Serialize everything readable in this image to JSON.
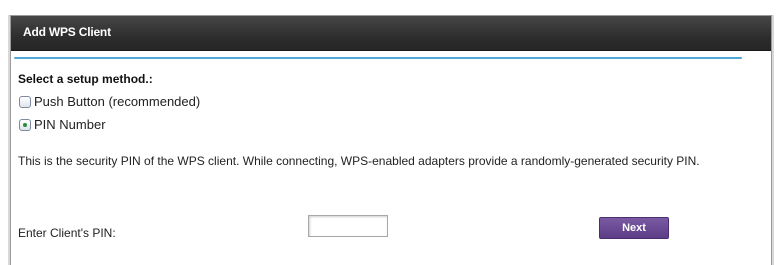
{
  "dialog": {
    "title": "Add WPS Client"
  },
  "setup": {
    "heading": "Select a setup method.:",
    "options": [
      {
        "label": "Push Button (recommended)",
        "selected": false
      },
      {
        "label": "PIN Number",
        "selected": true
      }
    ]
  },
  "description": "This is the security PIN of the WPS client. While connecting, WPS-enabled adapters provide a randomly-generated security PIN.",
  "pin": {
    "label": "Enter Client's PIN:",
    "value": "",
    "placeholder": ""
  },
  "buttons": {
    "next_label": "Next"
  },
  "colors": {
    "titlebar": "#2e2e2e",
    "accent_rule": "#4fa9d8",
    "next_button": "#5c3d86"
  }
}
